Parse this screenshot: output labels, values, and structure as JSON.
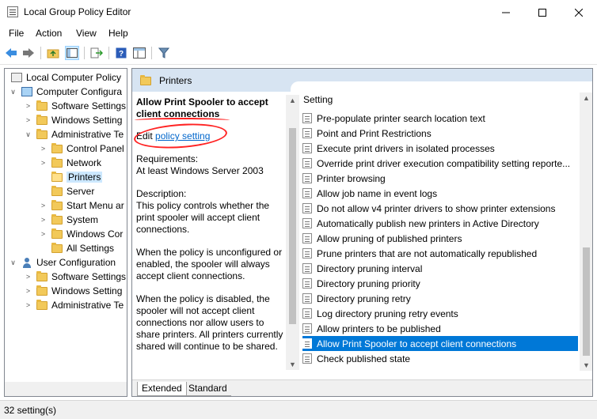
{
  "window": {
    "title": "Local Group Policy Editor"
  },
  "menu": [
    "File",
    "Action",
    "View",
    "Help"
  ],
  "tree": [
    {
      "label": "Local Computer Policy",
      "icon": "gpo-icon",
      "expander": ""
    },
    {
      "label": "Computer Configura",
      "icon": "computer-icon",
      "expander": "∨"
    },
    {
      "label": "Software Settings",
      "icon": "folder-icon",
      "expander": ">"
    },
    {
      "label": "Windows Setting",
      "icon": "folder-icon",
      "expander": ">"
    },
    {
      "label": "Administrative Te",
      "icon": "folder-icon",
      "expander": "∨"
    },
    {
      "label": "Control Panel",
      "icon": "folder-icon",
      "expander": ">"
    },
    {
      "label": "Network",
      "icon": "folder-icon",
      "expander": ">"
    },
    {
      "label": "Printers",
      "icon": "folder-icon",
      "expander": ""
    },
    {
      "label": "Server",
      "icon": "folder-icon",
      "expander": ""
    },
    {
      "label": "Start Menu ar",
      "icon": "folder-icon",
      "expander": ">"
    },
    {
      "label": "System",
      "icon": "folder-icon",
      "expander": ">"
    },
    {
      "label": "Windows Cor",
      "icon": "folder-icon",
      "expander": ">"
    },
    {
      "label": "All Settings",
      "icon": "folder-icon",
      "expander": ""
    },
    {
      "label": "User Configuration",
      "icon": "user-icon",
      "expander": "∨"
    },
    {
      "label": "Software Settings",
      "icon": "folder-icon",
      "expander": ">"
    },
    {
      "label": "Windows Setting",
      "icon": "folder-icon",
      "expander": ">"
    },
    {
      "label": "Administrative Te",
      "icon": "folder-icon",
      "expander": ">"
    }
  ],
  "header": {
    "title": "Printers"
  },
  "description": {
    "title": "Allow Print Spooler to accept client connections",
    "edit_prefix": "Edit",
    "edit_link": "policy setting",
    "requirements_label": "Requirements:",
    "requirements_value": "At least Windows Server 2003",
    "description_label": "Description:",
    "paragraph1": "This policy controls whether the print spooler will accept client connections.",
    "paragraph2": "When the policy is unconfigured or enabled, the spooler will always accept client connections.",
    "paragraph3": "When the policy is disabled, the spooler will not accept client connections nor allow users to share printers.  All printers currently shared will continue to be shared."
  },
  "list": {
    "column_header": "Setting",
    "items": [
      "Pre-populate printer search location text",
      "Point and Print Restrictions",
      "Execute print drivers in isolated processes",
      "Override print driver execution compatibility setting reporte...",
      "Printer browsing",
      "Allow job name in event logs",
      "Do not allow v4 printer drivers to show printer extensions",
      "Automatically publish new printers in Active Directory",
      "Allow pruning of published printers",
      "Prune printers that are not automatically republished",
      "Directory pruning interval",
      "Directory pruning priority",
      "Directory pruning retry",
      "Log directory pruning retry events",
      "Allow printers to be published",
      "Allow Print Spooler to accept client connections",
      "Check published state"
    ],
    "selected_index": 15
  },
  "tabs": [
    "Extended",
    "Standard"
  ],
  "status": {
    "text": "32 setting(s)"
  },
  "colors": {
    "selection": "#0078d7",
    "header_band": "#d7e4f2",
    "annotation": "#ff2222"
  }
}
